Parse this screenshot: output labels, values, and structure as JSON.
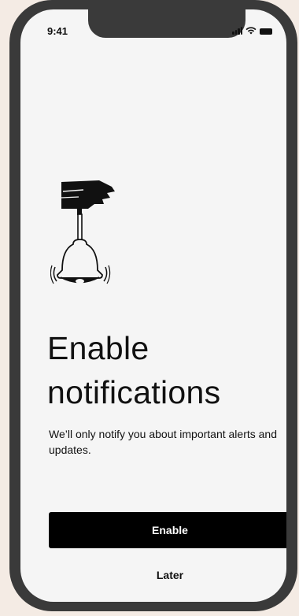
{
  "status_bar": {
    "time": "9:41",
    "icons": [
      "cellular-signal-icon",
      "wifi-icon",
      "battery-icon"
    ]
  },
  "illustration": {
    "icon": "hand-ringing-bell-icon"
  },
  "main": {
    "title": "Enable notifications",
    "subtitle": "We’ll only notify you about important alerts and updates."
  },
  "actions": {
    "enable_label": "Enable",
    "later_label": "Later"
  },
  "colors": {
    "background": "#f4ebe4",
    "device_frame": "#3a3a3a",
    "screen": "#f5f5f5",
    "primary_button": "#000000",
    "text": "#111111"
  }
}
